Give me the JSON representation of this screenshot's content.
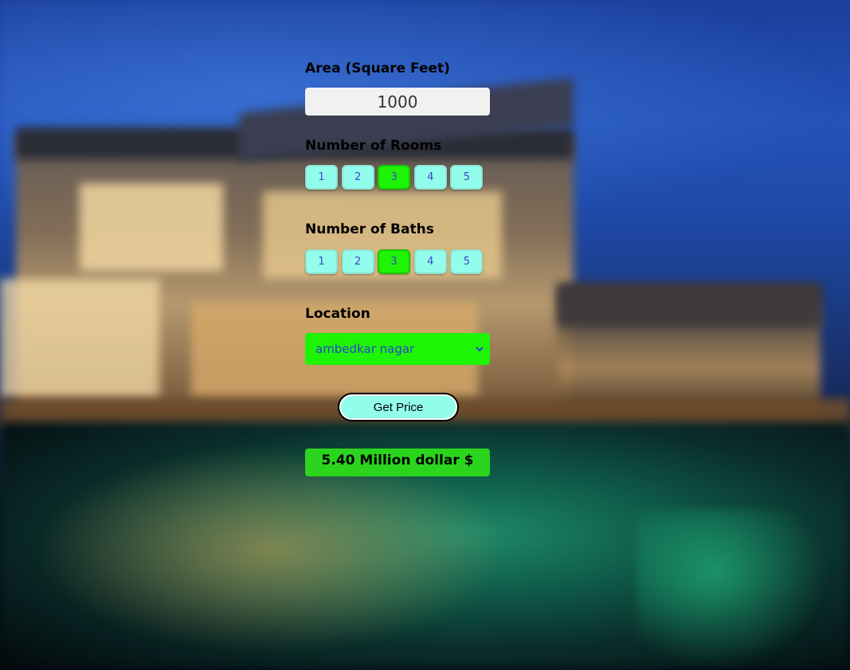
{
  "area": {
    "label": "Area (Square Feet)",
    "value": "1000"
  },
  "rooms": {
    "label": "Number of Rooms",
    "options": [
      "1",
      "2",
      "3",
      "4",
      "5"
    ],
    "selected": "3"
  },
  "baths": {
    "label": "Number of Baths",
    "options": [
      "1",
      "2",
      "3",
      "4",
      "5"
    ],
    "selected": "3"
  },
  "location": {
    "label": "Location",
    "selected": "ambedkar nagar"
  },
  "get_price_label": "Get Price",
  "result": "5.40 Million dollar $",
  "colors": {
    "option_bg": "#93fdeb",
    "selected_bg": "#1ff307",
    "select_bg": "#1ef406",
    "result_bg": "#2bd41d",
    "option_text": "#3c46c8"
  },
  "icons": {
    "background": "house-pool-photo",
    "select_arrow": "chevron-down-icon"
  }
}
